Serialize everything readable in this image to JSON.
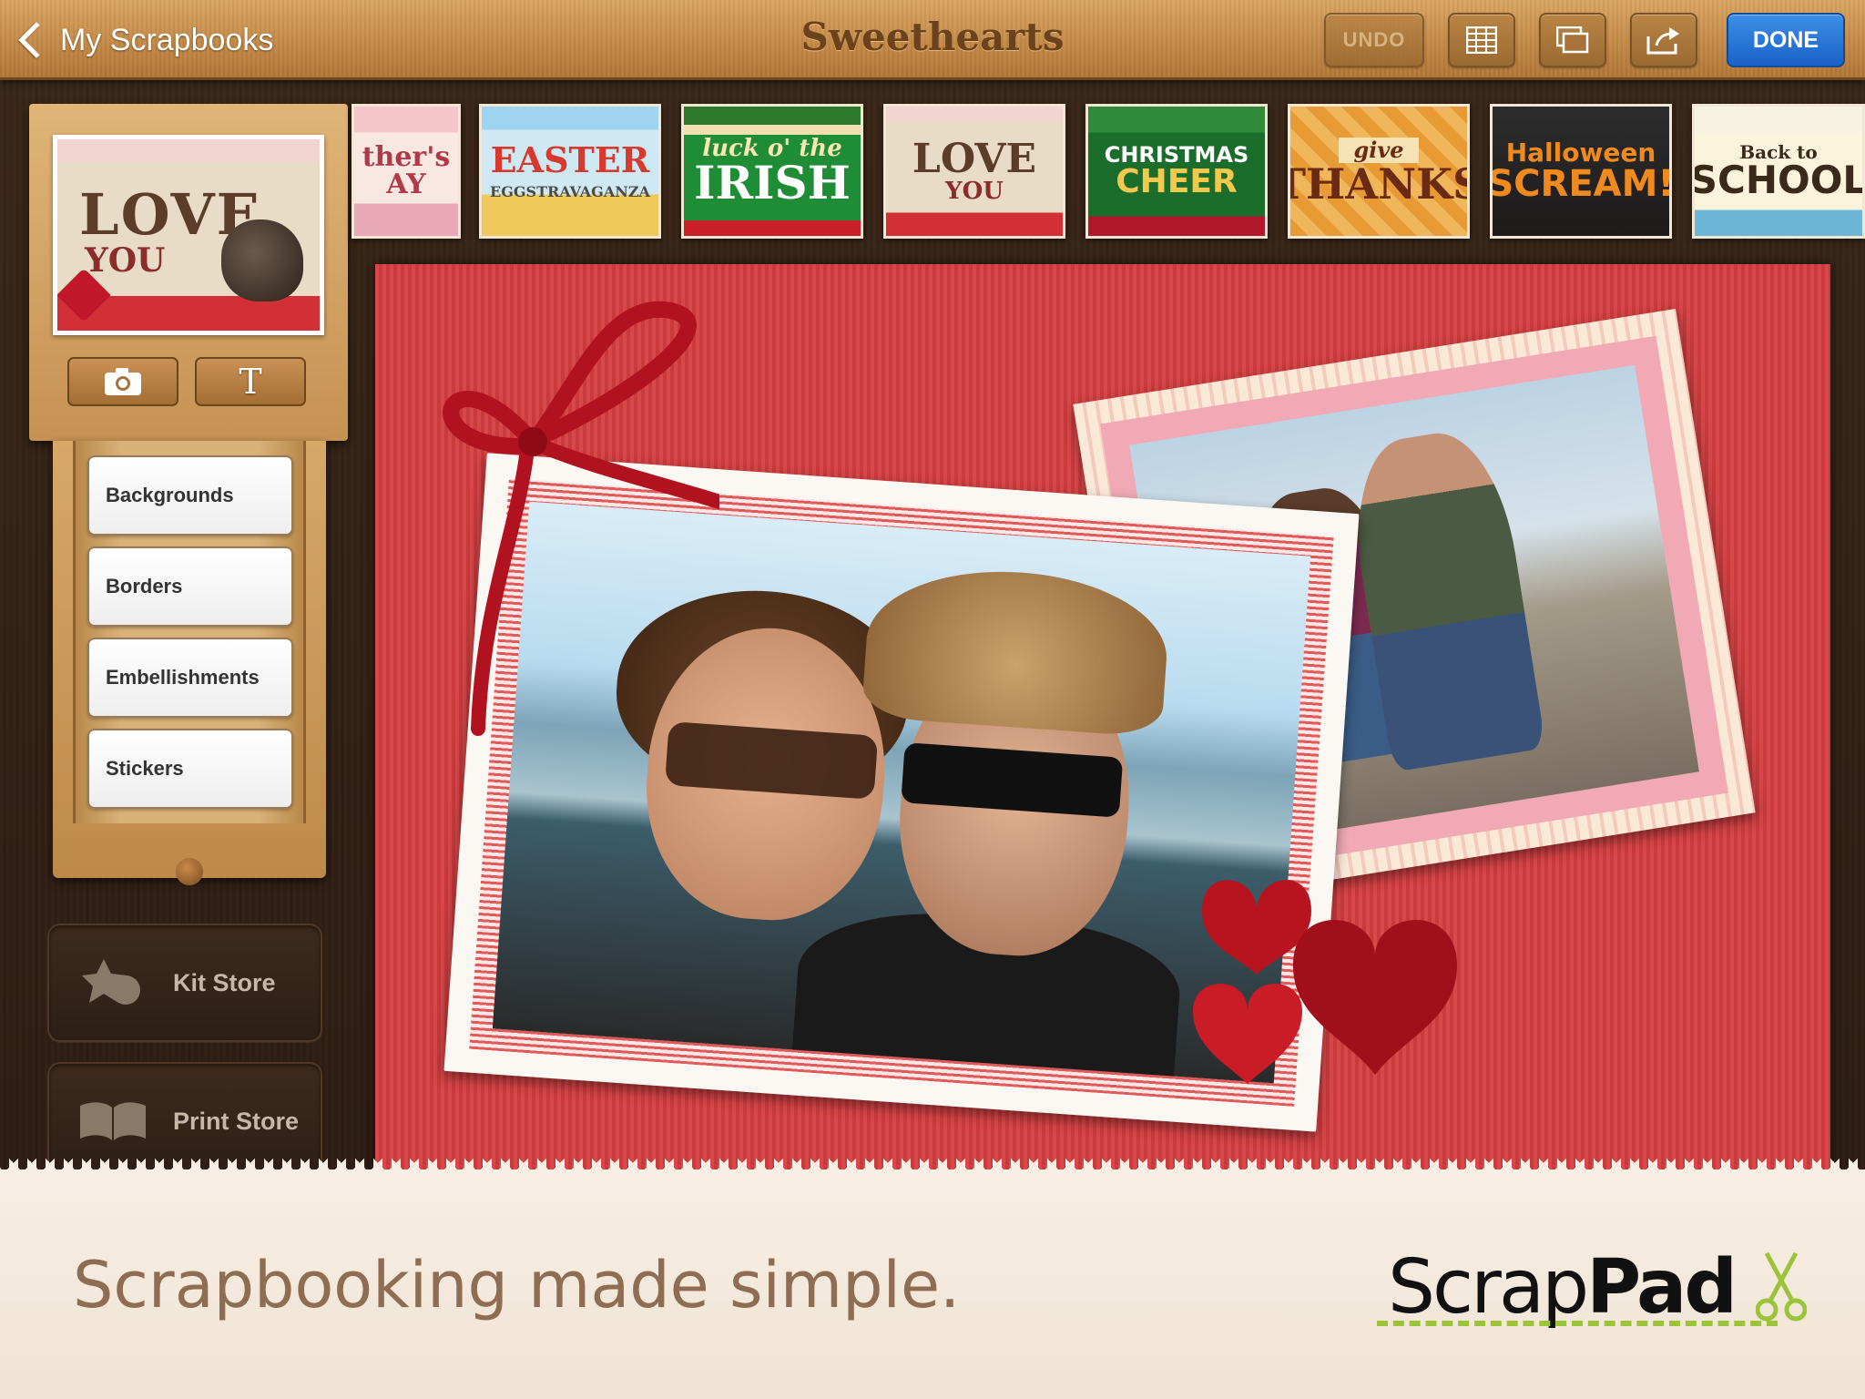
{
  "header": {
    "back_label": "My Scrapbooks",
    "title": "Sweethearts",
    "undo_label": "UNDO",
    "done_label": "DONE",
    "accent_color": "#1f6fd4",
    "icons": [
      "grid-icon",
      "pages-icon",
      "share-icon"
    ]
  },
  "sidebar": {
    "cover": {
      "line1": "LOVE",
      "line2": "YOU"
    },
    "tools": {
      "camera_icon": "camera-icon",
      "text_label": "T"
    },
    "categories": [
      {
        "label": "Backgrounds"
      },
      {
        "label": "Borders"
      },
      {
        "label": "Embellishments"
      },
      {
        "label": "Stickers"
      }
    ],
    "kit_store_label": "Kit Store",
    "print_store_label": "Print Store"
  },
  "kits": [
    {
      "line1": "ther's",
      "line2": "AY"
    },
    {
      "line1": "EASTER",
      "line2": "EGGSTRAVAGANZA"
    },
    {
      "line1": "luck o' the",
      "line2": "IRISH"
    },
    {
      "line1": "LOVE",
      "line2": "YOU"
    },
    {
      "line1": "CHRISTMAS",
      "line2": "CHEER"
    },
    {
      "line1": "give",
      "line2": "THANKS"
    },
    {
      "line1": "Halloween",
      "line2": "SCREAM!"
    },
    {
      "line1": "Back to",
      "line2": "SCHOOL"
    }
  ],
  "footer": {
    "tagline": "Scrapbooking made simple.",
    "logo_part1": "Scrap",
    "logo_part2": "Pad"
  }
}
